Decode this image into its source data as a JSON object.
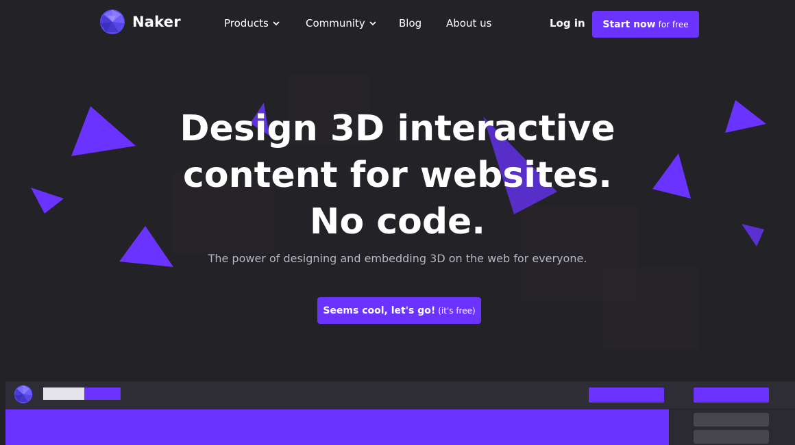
{
  "brand": {
    "name": "Naker",
    "logo_icon": "faceted-sphere-icon",
    "accent": "#6a33ff",
    "background": "#232226"
  },
  "nav": {
    "items": [
      {
        "label": "Products",
        "has_dropdown": true
      },
      {
        "label": "Community",
        "has_dropdown": true
      },
      {
        "label": "Blog",
        "has_dropdown": false
      },
      {
        "label": "About us",
        "has_dropdown": false
      }
    ],
    "login_label": "Log in",
    "start_label": "Start now",
    "start_sublabel": "for free"
  },
  "hero": {
    "line1": "Design 3D interactive",
    "line2": "content for websites.",
    "line3": "No code.",
    "subtitle": "The power of designing and embedding 3D on the web for everyone.",
    "cta_label": "Seems cool, let's go!",
    "cta_sublabel": "(it's free)"
  }
}
